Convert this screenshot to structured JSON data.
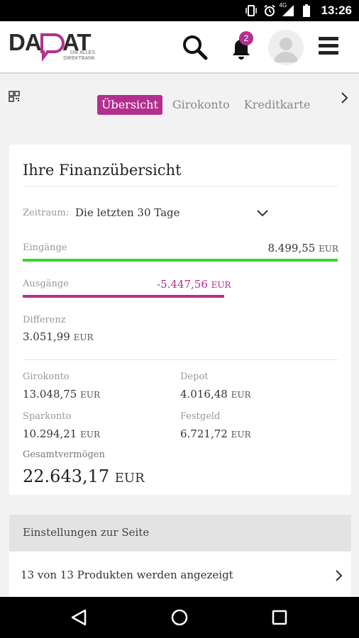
{
  "status_bar": {
    "time": "13:26",
    "network": "4G",
    "icons": [
      "vibrate-icon",
      "alarm-icon",
      "signal-icon",
      "battery-icon"
    ]
  },
  "header": {
    "logo_text": "DADAT",
    "logo_subtitle_line1": "DIE ALLES",
    "logo_subtitle_line2": "DIREKTBANK",
    "notification_count": "2",
    "icons": [
      "search-icon",
      "bell-icon",
      "avatar-icon",
      "menu-icon"
    ]
  },
  "tabs": [
    {
      "label": "Übersicht",
      "active": true
    },
    {
      "label": "Girokonto",
      "active": false
    },
    {
      "label": "Kreditkarte",
      "active": false
    }
  ],
  "overview": {
    "title": "Ihre Finanzübersicht",
    "period_label": "Zeitraum:",
    "period_value": "Die letzten 30 Tage",
    "income_label": "Eingänge",
    "income_amount": "8.499,55",
    "income_currency": "EUR",
    "income_fraction": 1.0,
    "expense_label": "Ausgänge",
    "expense_amount": "-5.447,56",
    "expense_currency": "EUR",
    "expense_fraction": 0.64,
    "difference_label": "Differenz",
    "difference_amount": "3.051,99",
    "difference_currency": "EUR",
    "accounts": {
      "giro_label": "Girokonto",
      "giro_amount": "13.048,75",
      "depot_label": "Depot",
      "depot_amount": "4.016,48",
      "spar_label": "Sparkonto",
      "spar_amount": "10.294,21",
      "fest_label": "Festgeld",
      "fest_amount": "6.721,72",
      "currency": "EUR"
    },
    "total_label": "Gesamtvermögen",
    "total_amount": "22.643,17",
    "total_currency": "EUR"
  },
  "settings": {
    "header": "Einstellungen zur Seite",
    "products_text": "13 von 13 Produkten werden angezeigt"
  },
  "colors": {
    "brand": "#b32f8f",
    "income": "#37d62b"
  }
}
